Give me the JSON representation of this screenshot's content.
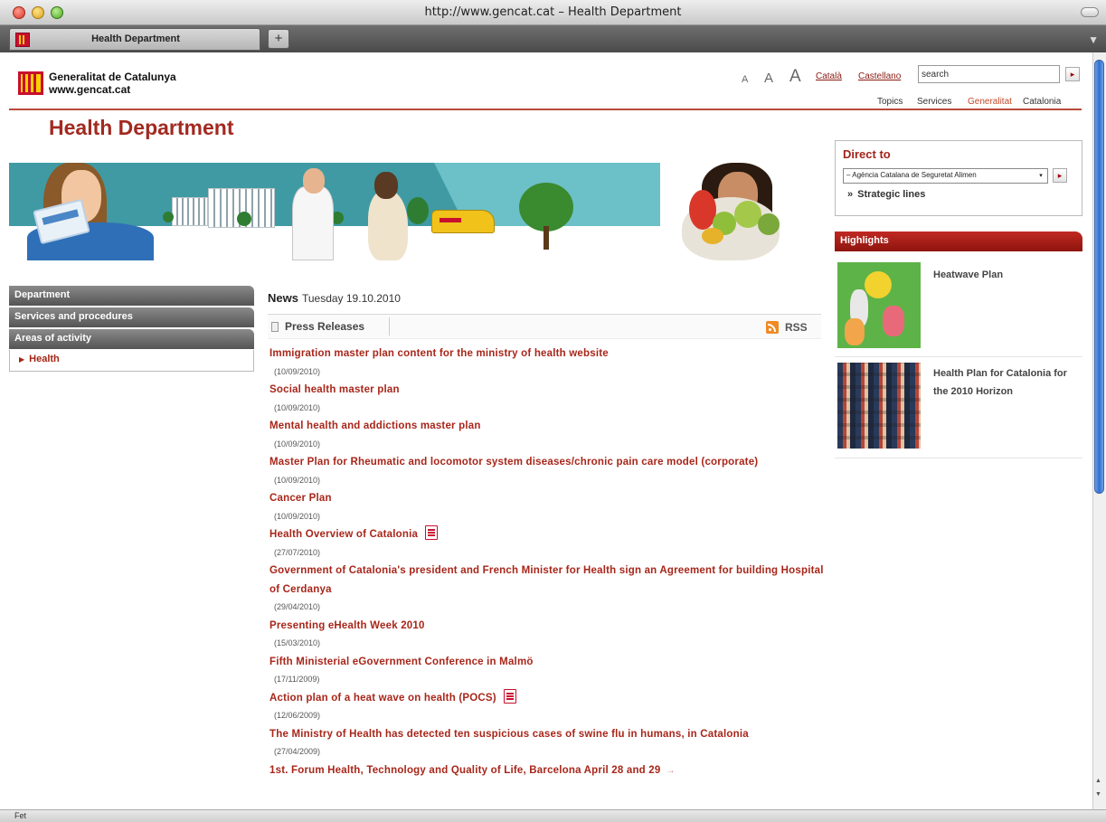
{
  "browser": {
    "window_title": "http://www.gencat.cat – Health Department",
    "tab_label": "Health Department",
    "new_tab_label": "+",
    "status_text": "Fet"
  },
  "header": {
    "logo_line1": "Generalitat de Catalunya",
    "logo_line2": "www.gencat.cat",
    "font_sizes": [
      "A",
      "A",
      "A"
    ],
    "languages": [
      "Català",
      "Castellano"
    ],
    "search_value": "search",
    "search_go": "▸",
    "topnav": [
      "Topics",
      "Services",
      "Generalitat",
      "Catalonia"
    ],
    "colors": {
      "accent": "#a8261a",
      "active_nav": "#c14a2a"
    }
  },
  "page": {
    "title": "Health Department"
  },
  "left_nav": {
    "items": [
      "Department",
      "Services and procedures",
      "Areas of activity"
    ],
    "sub_item": "Health",
    "sub_marker": "▶"
  },
  "news": {
    "label": "News",
    "date": "Tuesday 19.10.2010",
    "section": "Press Releases",
    "rss": "RSS",
    "items": [
      {
        "title": "Immigration master plan content for the ministry of health website",
        "date": "(10/09/2010)"
      },
      {
        "title": "Social health master plan",
        "date": "(10/09/2010)"
      },
      {
        "title": "Mental health and addictions master plan",
        "date": "(10/09/2010)"
      },
      {
        "title": "Master Plan for Rheumatic and locomotor system diseases/chronic pain care model (corporate)",
        "date": "(10/09/2010)"
      },
      {
        "title": "Cancer Plan",
        "date": "(10/09/2010)"
      },
      {
        "title": "Health Overview of Catalonia",
        "date": "(27/07/2010)"
      },
      {
        "title": "Government of Catalonia's president and French Minister for Health sign an Agreement for building Hospital of Cerdanya",
        "date": "(29/04/2010)"
      },
      {
        "title": "Presenting eHealth Week 2010",
        "date": "(15/03/2010)"
      },
      {
        "title": "Fifth Ministerial eGovernment Conference in Malmö",
        "date": "(17/11/2009)"
      },
      {
        "title": "Action plan of a heat wave on health (POCS)",
        "date": "(12/06/2009)"
      },
      {
        "title": "The Ministry of Health has detected ten suspicious cases of swine flu in humans, in Catalonia",
        "date": "(27/04/2009)"
      },
      {
        "title": "1st. Forum Health, Technology and Quality of Life, Barcelona April 28 and 29",
        "date": ""
      }
    ]
  },
  "direct_to": {
    "title": "Direct to",
    "select_value": "– Agència Catalana de Seguretat Alimen",
    "select_arrow": "▾",
    "go": "▸",
    "strategic_marker": "»",
    "strategic_label": "Strategic lines"
  },
  "highlights": {
    "label": "Highlights",
    "items": [
      {
        "title": "Heatwave Plan"
      },
      {
        "title": "Health Plan for Catalonia for the 2010 Horizon"
      }
    ]
  },
  "scrollbar": {
    "up": "▲",
    "down": "▼"
  }
}
